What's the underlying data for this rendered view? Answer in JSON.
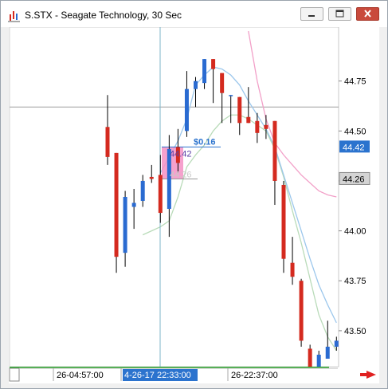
{
  "window": {
    "title": "S.STX - Seagate Technology, 30 Sec",
    "controls": [
      "minimize",
      "maximize",
      "close"
    ]
  },
  "colors": {
    "up": "#2a6bd1",
    "down": "#d42a1f",
    "ma_blue": "#9cc7ec",
    "ma_green": "#b9dbb9",
    "ma_pink": "#f2a0c8",
    "price_line": "#a0a0a0",
    "current_price_tag": "#2b73ce",
    "crosshair": "#7eb4c8",
    "measure_box": "#f590c4",
    "volume_strip": "#33aa33",
    "scroll_arrow": "#e02020"
  },
  "chart_data": {
    "type": "candlestick",
    "ylim": [
      43.32,
      45.02
    ],
    "y_ticks": [
      "44.75",
      "44.50",
      "44.25",
      "44.00",
      "43.75",
      "43.50"
    ],
    "current_price_label": "44.42",
    "reference_price_label": "44.26",
    "reference_price": 44.62,
    "x_tick_labels": [
      "26-04:57:00",
      "4-26-17 22:33:00",
      "26-22:37:00"
    ],
    "measurement": {
      "change_label": "$0.16",
      "from_label": "44.26",
      "to_label": "44.42"
    },
    "candles": [
      {
        "o": 44.52,
        "h": 44.68,
        "l": 44.33,
        "c": 44.37
      },
      {
        "o": 44.39,
        "h": 44.39,
        "l": 43.79,
        "c": 43.87
      },
      {
        "o": 43.89,
        "h": 44.2,
        "l": 43.82,
        "c": 44.17
      },
      {
        "o": 44.12,
        "h": 44.21,
        "l": 44.01,
        "c": 44.14
      },
      {
        "o": 44.15,
        "h": 44.28,
        "l": 44.12,
        "c": 44.25
      },
      {
        "o": 44.27,
        "h": 44.33,
        "l": 44.24,
        "c": 44.26
      },
      {
        "o": 44.28,
        "h": 44.38,
        "l": 44.04,
        "c": 44.09
      },
      {
        "o": 44.11,
        "h": 44.48,
        "l": 43.97,
        "c": 44.41
      },
      {
        "o": 44.42,
        "h": 44.51,
        "l": 44.29,
        "c": 44.34
      },
      {
        "o": 44.5,
        "h": 44.8,
        "l": 44.47,
        "c": 44.71
      },
      {
        "o": 44.71,
        "h": 44.77,
        "l": 44.62,
        "c": 44.75
      },
      {
        "o": 44.74,
        "h": 44.86,
        "l": 44.71,
        "c": 44.86
      },
      {
        "o": 44.86,
        "h": 44.86,
        "l": 44.64,
        "c": 44.81
      },
      {
        "o": 44.79,
        "h": 44.79,
        "l": 44.54,
        "c": 44.69
      },
      {
        "o": 44.68,
        "h": 44.68,
        "l": 44.54,
        "c": 44.68
      },
      {
        "o": 44.67,
        "h": 44.67,
        "l": 44.48,
        "c": 44.54
      },
      {
        "o": 44.57,
        "h": 44.72,
        "l": 44.54,
        "c": 44.54
      },
      {
        "o": 44.55,
        "h": 44.59,
        "l": 44.44,
        "c": 44.49
      },
      {
        "o": 44.53,
        "h": 44.58,
        "l": 44.46,
        "c": 44.51
      },
      {
        "o": 44.55,
        "h": 44.55,
        "l": 44.13,
        "c": 44.25
      },
      {
        "o": 44.23,
        "h": 44.25,
        "l": 43.79,
        "c": 43.86
      },
      {
        "o": 43.84,
        "h": 43.97,
        "l": 43.73,
        "c": 43.77
      },
      {
        "o": 43.75,
        "h": 43.76,
        "l": 43.42,
        "c": 43.45
      },
      {
        "o": 43.41,
        "h": 43.43,
        "l": 43.32,
        "c": 43.32
      },
      {
        "o": 43.32,
        "h": 43.4,
        "l": 43.32,
        "c": 43.38
      },
      {
        "o": 43.36,
        "h": 43.55,
        "l": 43.36,
        "c": 43.42
      },
      {
        "o": 43.42,
        "h": 43.47,
        "l": 43.4,
        "c": 43.45
      }
    ],
    "ma_blue": [
      null,
      null,
      null,
      null,
      null,
      null,
      44.29,
      44.37,
      44.45,
      44.56,
      44.73,
      44.78,
      44.82,
      44.81,
      44.78,
      44.73,
      44.65,
      44.58,
      44.51,
      44.42,
      44.28,
      44.14,
      44.0,
      43.86,
      43.73,
      43.63,
      43.54
    ],
    "ma_green": [
      null,
      null,
      null,
      null,
      43.98,
      44.0,
      44.02,
      44.05,
      44.17,
      44.32,
      44.38,
      44.43,
      44.5,
      44.55,
      44.58,
      44.58,
      44.56,
      44.53,
      44.5,
      44.41,
      44.27,
      44.1,
      43.94,
      43.76,
      43.58,
      43.47,
      43.4
    ],
    "ma_pink": [
      null,
      null,
      null,
      null,
      null,
      null,
      null,
      null,
      null,
      null,
      null,
      null,
      null,
      null,
      null,
      null,
      45.0,
      44.75,
      44.56,
      44.44,
      44.38,
      44.33,
      44.28,
      44.24,
      44.2,
      44.18,
      44.17
    ]
  }
}
